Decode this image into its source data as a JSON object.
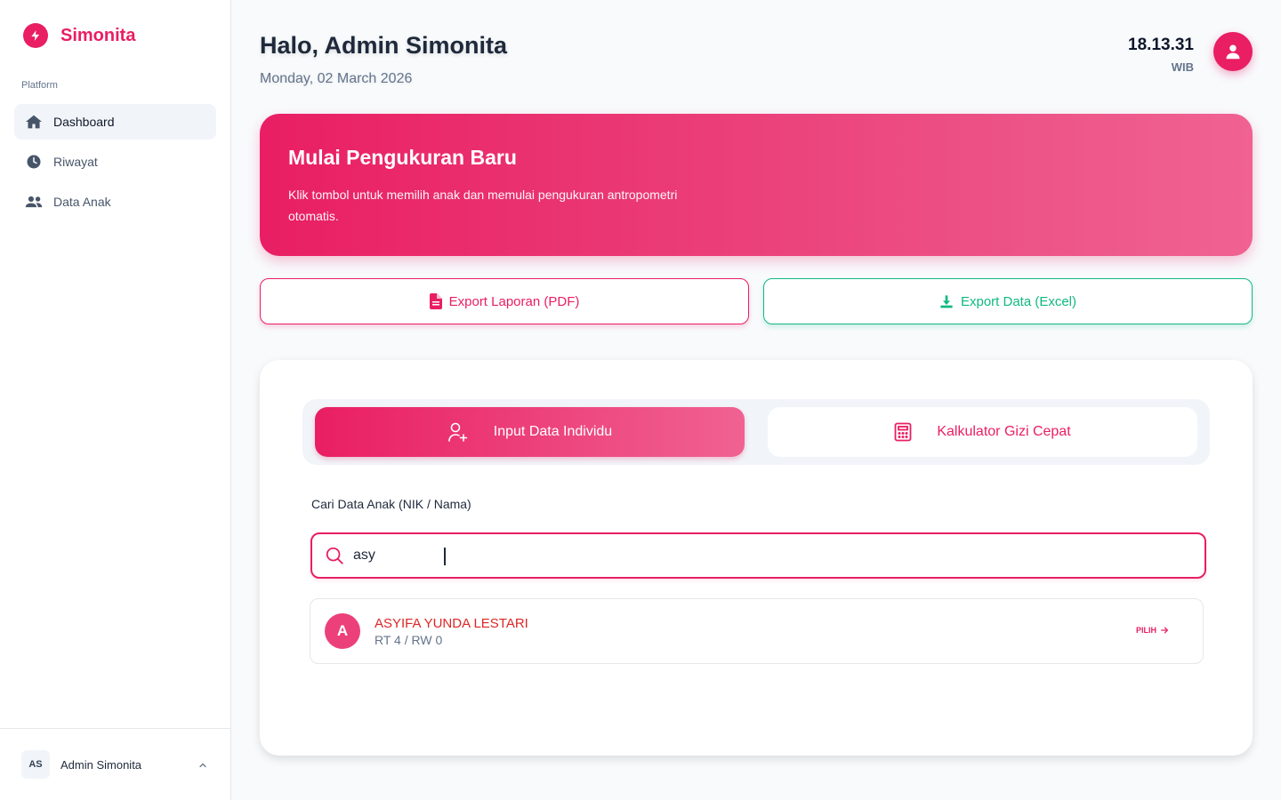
{
  "app": {
    "name": "Simonita"
  },
  "sidebar": {
    "section_label": "Platform",
    "items": [
      {
        "label": "Dashboard",
        "icon": "home-icon",
        "active": true
      },
      {
        "label": "Riwayat",
        "icon": "clock-icon",
        "active": false
      },
      {
        "label": "Data Anak",
        "icon": "users-icon",
        "active": false
      }
    ],
    "footer": {
      "initials": "AS",
      "name": "Admin Simonita"
    }
  },
  "header": {
    "greeting": "Halo, Admin Simonita",
    "date": "Monday, 02 March 2026",
    "time": "18.13.31",
    "timezone": "WIB"
  },
  "hero": {
    "title": "Mulai Pengukuran Baru",
    "description": "Klik tombol untuk memilih anak dan memulai pengukuran antropometri otomatis."
  },
  "export": {
    "pdf_label": "Export Laporan (PDF)",
    "excel_label": "Export Data (Excel)"
  },
  "tabs": [
    {
      "label": "Input Data Individu",
      "active": true
    },
    {
      "label": "Kalkulator Gizi Cepat",
      "active": false
    }
  ],
  "search": {
    "label": "Cari Data Anak (NIK / Nama)",
    "value": "asy"
  },
  "results": [
    {
      "initial": "A",
      "name": "ASYIFA YUNDA LESTARI",
      "sub": "RT 4 / RW 0",
      "action": "PILIH"
    }
  ],
  "colors": {
    "primary": "#e91e63",
    "success": "#10b981",
    "name_red": "#dc2626"
  }
}
